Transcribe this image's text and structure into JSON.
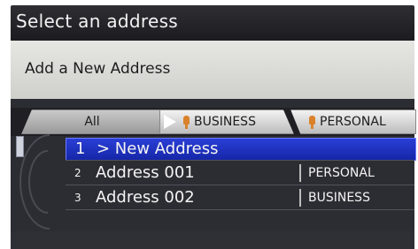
{
  "header": {
    "title": "Select an address"
  },
  "info": {
    "text": "Add a New Address"
  },
  "tabs": [
    {
      "label": "All",
      "icon": "right-arrow-icon",
      "active": true
    },
    {
      "label": "BUSINESS",
      "icon": "pin-icon",
      "active": false
    },
    {
      "label": "PERSONAL",
      "icon": "pin-icon",
      "active": false
    }
  ],
  "list": {
    "items": [
      {
        "number": "1",
        "name": "> New Address",
        "type": "",
        "selected": true
      },
      {
        "number": "2",
        "name": "Address 001",
        "type": "PERSONAL",
        "selected": false
      },
      {
        "number": "3",
        "name": "Address 002",
        "type": "BUSINESS",
        "selected": false
      }
    ]
  },
  "colors": {
    "selection": "#1e33c4",
    "pin": "#d9822b"
  }
}
